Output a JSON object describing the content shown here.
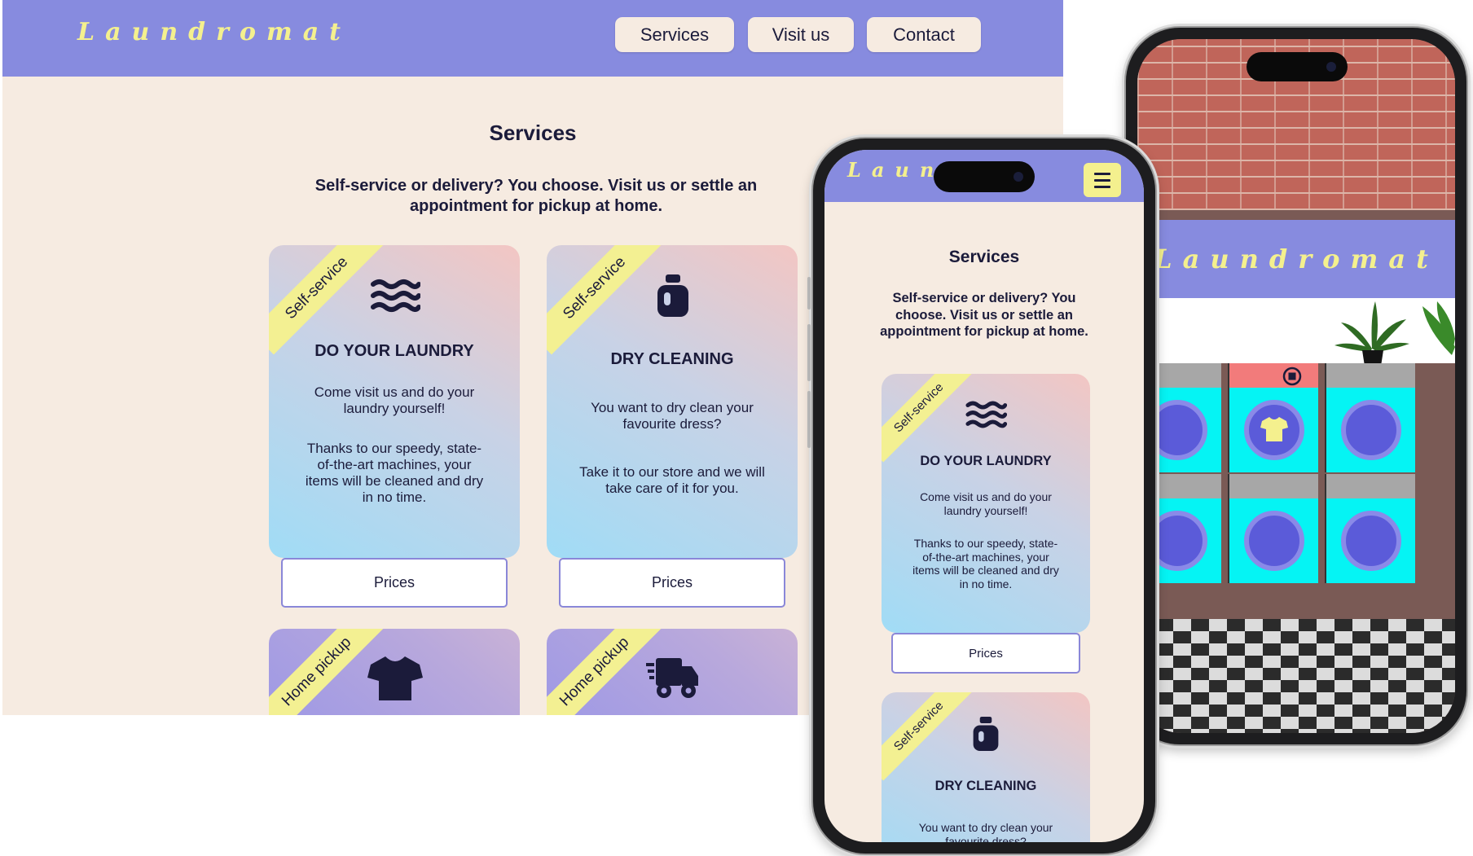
{
  "desktop": {
    "logo": "Laundromat",
    "nav": [
      "Services",
      "Visit us",
      "Contact"
    ],
    "title": "Services",
    "subtitle": "Self-service or delivery? You choose. Visit us or settle an appointment for pickup at home.",
    "cards": [
      {
        "ribbon": "Self-service",
        "icon": "waves-icon",
        "title": "DO YOUR LAUNDRY",
        "p1": "Come visit us and do your laundry yourself!",
        "p2": "Thanks to our speedy, state-of-the-art machines, your items will be cleaned and dry in no time.",
        "button": "Prices"
      },
      {
        "ribbon": "Self-service",
        "icon": "detergent-bottle-icon",
        "title": "DRY CLEANING",
        "p1": "You want to dry clean your favourite dress?",
        "p2": "Take it to our store and we will take care of it for you.",
        "button": "Prices"
      },
      {
        "ribbon": "Home pickup",
        "icon": "tshirt-icon"
      },
      {
        "ribbon": "Home pickup",
        "icon": "delivery-truck-icon"
      }
    ]
  },
  "mobile": {
    "logo": "Laund",
    "title": "Services",
    "subtitle": "Self-service or delivery? You choose. Visit us or settle an appointment for pickup at home.",
    "cards": [
      {
        "ribbon": "Self-service",
        "icon": "waves-icon",
        "title": "DO YOUR LAUNDRY",
        "p1": "Come visit us and do your laundry yourself!",
        "p2": "Thanks to our speedy, state-of-the-art machines, your items will be cleaned and dry in no time.",
        "button": "Prices"
      },
      {
        "ribbon": "Self-service",
        "icon": "detergent-bottle-icon",
        "title": "DRY CLEANING",
        "p1": "You want to dry clean your favourite dress?"
      }
    ]
  },
  "game": {
    "sign": "Laundromat",
    "machines": 6,
    "active_machine": 2
  },
  "colors": {
    "header": "#878bdf",
    "logo": "#f4f08e",
    "page_bg": "#f6ebe1",
    "text": "#1b1b3a",
    "ribbon": "#f3f092"
  }
}
